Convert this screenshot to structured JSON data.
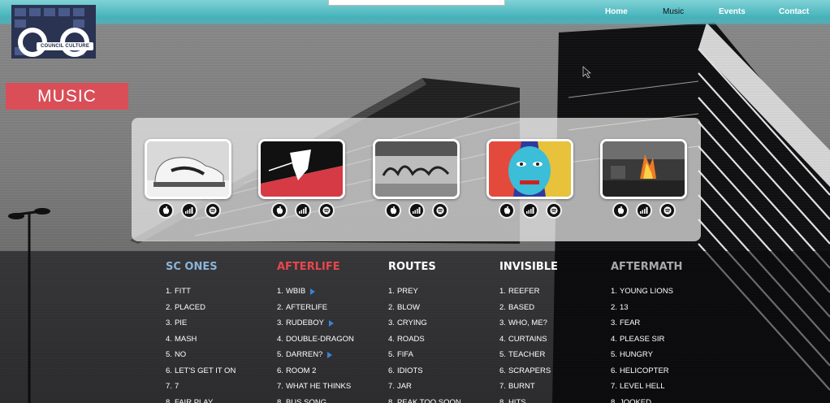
{
  "header": {
    "logo_text": "COUNCIL CULTURE",
    "nav": [
      {
        "label": "Home",
        "active": false
      },
      {
        "label": "Music",
        "active": true
      },
      {
        "label": "Events",
        "active": false
      },
      {
        "label": "Contact",
        "active": false
      }
    ]
  },
  "page": {
    "section_title": "MUSIC"
  },
  "albums": [
    {
      "art": "sneaker",
      "links": [
        "apple-music-icon",
        "soundcloud-icon",
        "spotify-icon"
      ]
    },
    {
      "art": "afterlife-graphic",
      "links": [
        "apple-music-icon",
        "soundcloud-icon",
        "spotify-icon"
      ]
    },
    {
      "art": "graffiti-wall",
      "links": [
        "apple-music-icon",
        "soundcloud-icon",
        "spotify-icon"
      ]
    },
    {
      "art": "painted-face",
      "links": [
        "apple-music-icon",
        "soundcloud-icon",
        "spotify-icon"
      ]
    },
    {
      "art": "burning-street",
      "links": [
        "apple-music-icon",
        "soundcloud-icon",
        "spotify-icon"
      ]
    }
  ],
  "tracklists": [
    {
      "title": "SC ONES",
      "color": "#8ab4d8",
      "tracks": [
        {
          "num": "1.",
          "name": "FITT",
          "playable": false
        },
        {
          "num": "2.",
          "name": "PLACED",
          "playable": false
        },
        {
          "num": "3.",
          "name": "PIE",
          "playable": false
        },
        {
          "num": "4.",
          "name": "MASH",
          "playable": false
        },
        {
          "num": "5.",
          "name": "NO",
          "playable": false
        },
        {
          "num": "6.",
          "name": "LET'S GET IT ON",
          "playable": false
        },
        {
          "num": "7.",
          "name": "7",
          "playable": false
        },
        {
          "num": "8.",
          "name": "FAIR PLAY",
          "playable": false
        }
      ]
    },
    {
      "title": "AFTERLIFE",
      "color": "#e8474c",
      "tracks": [
        {
          "num": "1.",
          "name": "WBIB",
          "playable": true
        },
        {
          "num": "2.",
          "name": "AFTERLIFE",
          "playable": false
        },
        {
          "num": "3.",
          "name": "RUDEBOY",
          "playable": true
        },
        {
          "num": "4.",
          "name": "DOUBLE-DRAGON",
          "playable": false
        },
        {
          "num": "5.",
          "name": "DARREN?",
          "playable": true
        },
        {
          "num": "6.",
          "name": "ROOM 2",
          "playable": false
        },
        {
          "num": "7.",
          "name": "WHAT HE THINKS",
          "playable": false
        },
        {
          "num": "8.",
          "name": "BUS SONG",
          "playable": false
        }
      ]
    },
    {
      "title": "ROUTES",
      "color": "#ffffff",
      "tracks": [
        {
          "num": "1.",
          "name": "PREY",
          "playable": false
        },
        {
          "num": "2.",
          "name": "BLOW",
          "playable": false
        },
        {
          "num": "3.",
          "name": "CRYING",
          "playable": false
        },
        {
          "num": "4.",
          "name": "ROADS",
          "playable": false
        },
        {
          "num": "5.",
          "name": "FIFA",
          "playable": false
        },
        {
          "num": "6.",
          "name": "IDIOTS",
          "playable": false
        },
        {
          "num": "7.",
          "name": "JAR",
          "playable": false
        },
        {
          "num": "8.",
          "name": "PEAK TOO SOON",
          "playable": false
        }
      ]
    },
    {
      "title": "INVISIBLE",
      "color": "#ffffff",
      "tracks": [
        {
          "num": "1.",
          "name": "REEFER",
          "playable": false
        },
        {
          "num": "2.",
          "name": "BASED",
          "playable": false
        },
        {
          "num": "3.",
          "name": "WHO, ME?",
          "playable": false
        },
        {
          "num": "4.",
          "name": "CURTAINS",
          "playable": false
        },
        {
          "num": "5.",
          "name": "TEACHER",
          "playable": false
        },
        {
          "num": "6.",
          "name": "SCRAPERS",
          "playable": false
        },
        {
          "num": "7.",
          "name": "BURNT",
          "playable": false
        },
        {
          "num": "8.",
          "name": "HITS",
          "playable": false
        }
      ]
    },
    {
      "title": "AFTERMATH",
      "color": "#a9a9a9",
      "tracks": [
        {
          "num": "1.",
          "name": "YOUNG LIONS",
          "playable": false
        },
        {
          "num": "2.",
          "name": "13",
          "playable": false
        },
        {
          "num": "3.",
          "name": "FEAR",
          "playable": false
        },
        {
          "num": "4.",
          "name": "PLEASE SIR",
          "playable": false
        },
        {
          "num": "5.",
          "name": "HUNGRY",
          "playable": false
        },
        {
          "num": "6.",
          "name": "HELICOPTER",
          "playable": false
        },
        {
          "num": "7.",
          "name": "LEVEL HELL",
          "playable": false
        },
        {
          "num": "8.",
          "name": "JOOKED",
          "playable": false
        }
      ]
    }
  ]
}
